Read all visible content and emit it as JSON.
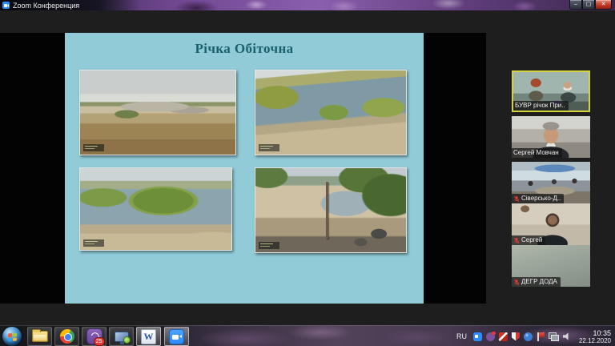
{
  "window": {
    "title": "Zoom Конференция",
    "controls": {
      "minimize": "–",
      "maximize": "▢",
      "close": "✕"
    }
  },
  "slide": {
    "title": "Річка Обіточна",
    "photos": [
      {
        "icon": "dry-steppe-riverbed-photo"
      },
      {
        "icon": "river-reeds-shore-photo"
      },
      {
        "icon": "river-bend-reeds-photo"
      },
      {
        "icon": "dry-shore-trees-rocks-photo"
      }
    ],
    "background_color": "#90cbd7",
    "title_color": "#19606e"
  },
  "participants": [
    {
      "name": "БУВР річок При..",
      "active_speaker": true,
      "muted": false
    },
    {
      "name": "Сергей Мовчан",
      "active_speaker": false,
      "muted": false
    },
    {
      "name": "Сіверсько-Д..",
      "active_speaker": false,
      "muted": true
    },
    {
      "name": "Сергей",
      "active_speaker": false,
      "muted": true
    },
    {
      "name": "ДЕГР ДОДА",
      "active_speaker": false,
      "muted": true
    }
  ],
  "colors": {
    "active_speaker_border": "#d6d43e",
    "muted_mic": "#e04038",
    "taskbar_accent": "#2d8cff"
  },
  "taskbar": {
    "apps": [
      {
        "icon": "windows-start-icon"
      },
      {
        "icon": "explorer-folder-icon"
      },
      {
        "icon": "chrome-icon"
      },
      {
        "icon": "viber-icon",
        "badge": "25"
      },
      {
        "icon": "computer-monitor-icon"
      },
      {
        "icon": "word-icon",
        "letter": "W"
      },
      {
        "icon": "zoom-icon"
      }
    ],
    "viber_badge": "25",
    "word_letter": "W",
    "tray": {
      "language": "RU",
      "icons": [
        "zoom-tray-icon",
        "viber-tray-icon",
        "red-app-tray-icon",
        "antivirus-shield-tray-icon",
        "globe-tray-icon",
        "action-center-flag-icon",
        "network-icon",
        "volume-icon"
      ],
      "time": "10:35",
      "date": "22.12.2020"
    }
  }
}
